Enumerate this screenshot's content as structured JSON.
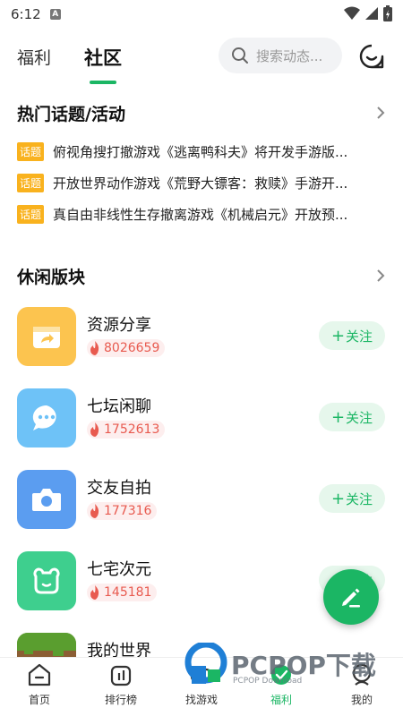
{
  "status": {
    "time": "6:12"
  },
  "tabs": [
    {
      "label": "福利"
    },
    {
      "label": "社区"
    }
  ],
  "search": {
    "placeholder": "搜索动态..."
  },
  "hot_topics": {
    "title": "热门话题/活动",
    "badge": "话题",
    "items": [
      {
        "text": "俯视角搜打撤游戏《逃离鸭科夫》将开发手游版..."
      },
      {
        "text": "开放世界动作游戏《荒野大镖客：救赎》手游开..."
      },
      {
        "text": "真自由非线性生存撤离游戏《机械启元》开放预..."
      }
    ]
  },
  "leisure": {
    "title": "休闲版块",
    "follow_label": "关注",
    "items": [
      {
        "name": "资源分享",
        "hot": "8026659",
        "color": "#fcc44f"
      },
      {
        "name": "七坛闲聊",
        "hot": "1752613",
        "color": "#6ec2f7"
      },
      {
        "name": "交友自拍",
        "hot": "177316",
        "color": "#5b9df0"
      },
      {
        "name": "七宅次元",
        "hot": "145181",
        "color": "#3ecf8e"
      },
      {
        "name": "我的世界",
        "hot": "",
        "color": "#6b8e3a"
      }
    ]
  },
  "bottom_nav": [
    {
      "label": "首页",
      "icon": "home-icon"
    },
    {
      "label": "排行榜",
      "icon": "ranking-icon"
    },
    {
      "label": "找游戏",
      "icon": "gamepad-icon"
    },
    {
      "label": "福利",
      "icon": "gift-icon"
    },
    {
      "label": "我的",
      "icon": "profile-icon"
    }
  ],
  "watermark": {
    "text": "PCPOP下载",
    "sub": "PCPOP Download"
  },
  "colors": {
    "accent": "#1bb664",
    "badge": "#f9b21e",
    "hot": "#e85a4f"
  }
}
